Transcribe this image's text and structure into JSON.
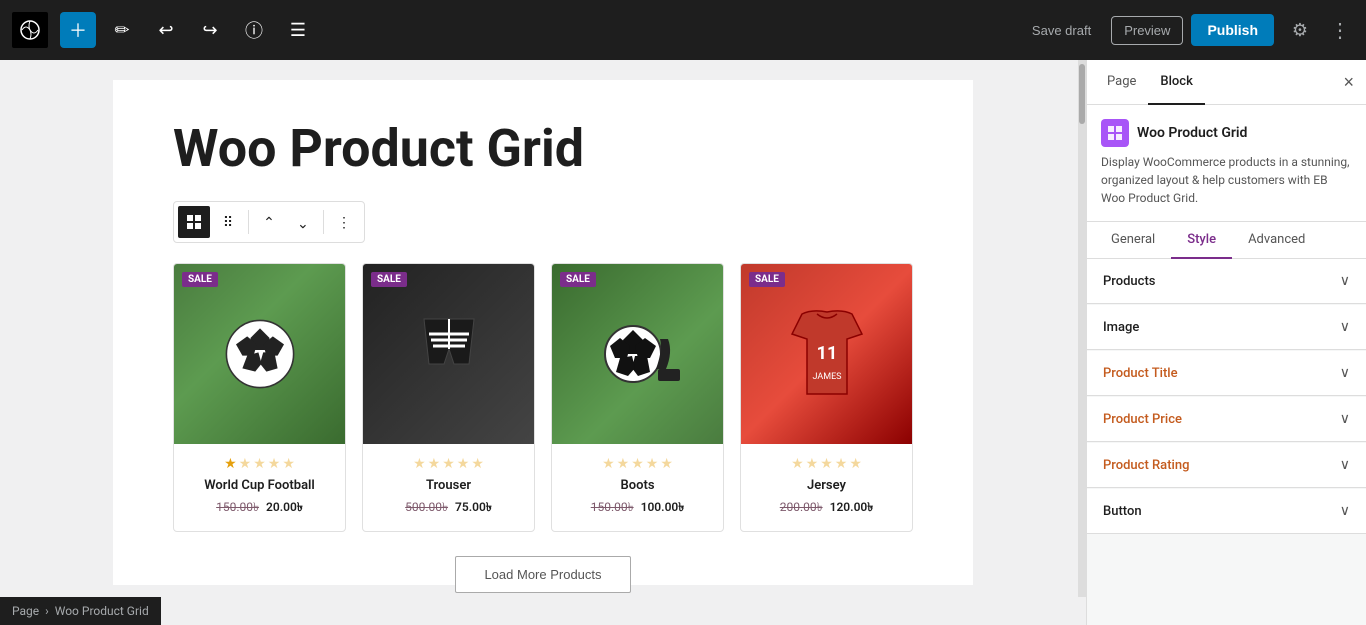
{
  "topbar": {
    "save_draft_label": "Save draft",
    "preview_label": "Preview",
    "publish_label": "Publish"
  },
  "breadcrumb": {
    "parent": "Page",
    "separator": "›",
    "current": "Woo Product Grid"
  },
  "editor": {
    "page_title": "Woo Product Grid"
  },
  "block_toolbar": {
    "buttons": [
      "grid-icon",
      "dots-icon",
      "arrows-icon",
      "more-icon"
    ]
  },
  "products": [
    {
      "name": "World Cup Football",
      "old_price": "150.00৳",
      "new_price": "20.00৳",
      "sale": "SALE",
      "image_type": "football"
    },
    {
      "name": "Trouser",
      "old_price": "500.00৳",
      "new_price": "75.00৳",
      "sale": "SALE",
      "image_type": "shorts"
    },
    {
      "name": "Boots",
      "old_price": "150.00৳",
      "new_price": "100.00৳",
      "sale": "SALE",
      "image_type": "boots"
    },
    {
      "name": "Jersey",
      "old_price": "200.00৳",
      "new_price": "120.00৳",
      "sale": "SALE",
      "image_type": "jersey"
    }
  ],
  "load_more_label": "Load More Products",
  "right_panel": {
    "tabs": [
      "Page",
      "Block"
    ],
    "active_tab": "Block",
    "block_name": "Woo Product Grid",
    "block_desc": "Display WooCommerce products in a stunning, organized layout & help customers with EB Woo Product Grid.",
    "sub_tabs": [
      "General",
      "Style",
      "Advanced"
    ],
    "active_sub_tab": "Style",
    "sections": [
      {
        "title": "Products",
        "color": "normal"
      },
      {
        "title": "Image",
        "color": "normal"
      },
      {
        "title": "Product Title",
        "color": "orange"
      },
      {
        "title": "Product Price",
        "color": "orange"
      },
      {
        "title": "Product Rating",
        "color": "orange"
      },
      {
        "title": "Button",
        "color": "normal"
      }
    ]
  }
}
